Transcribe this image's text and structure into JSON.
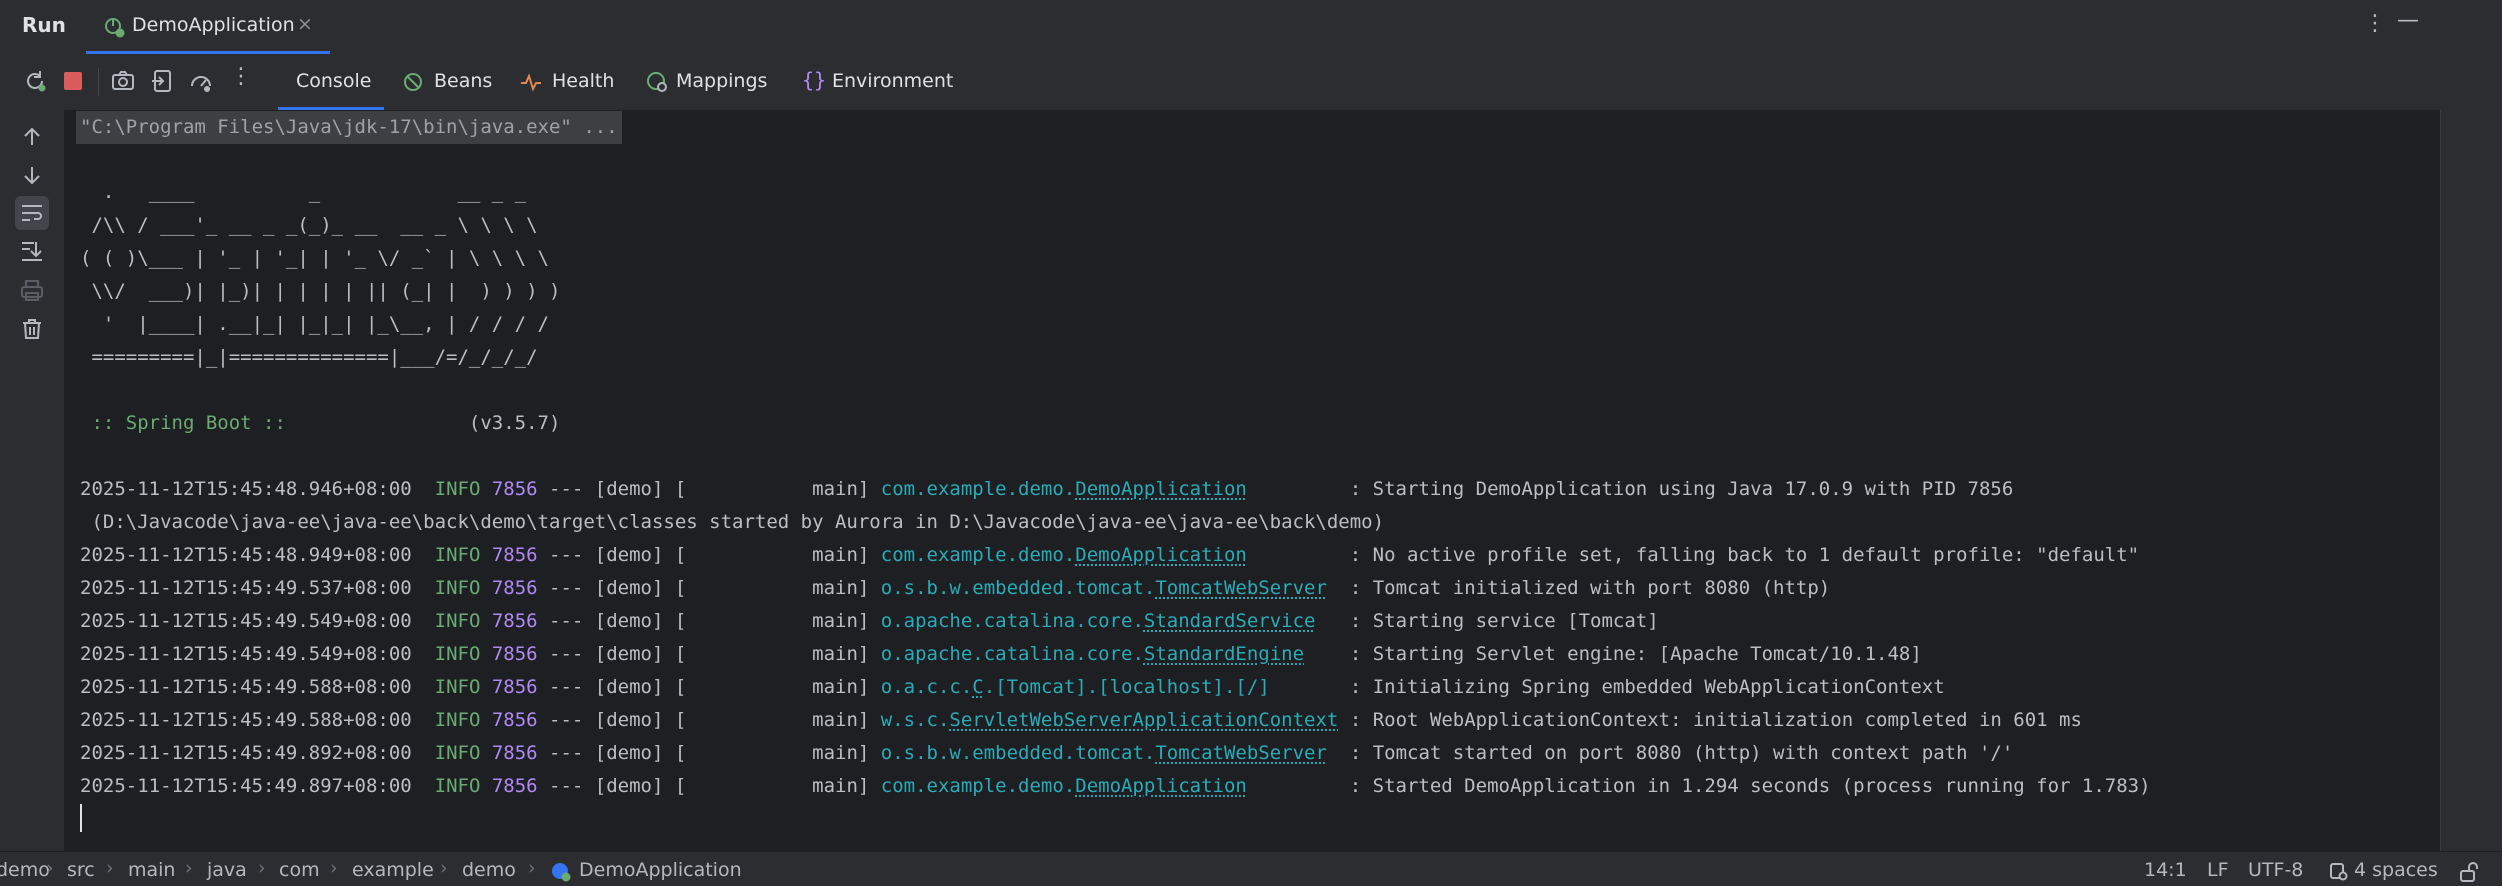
{
  "header": {
    "run_label": "Run",
    "tab_label": "DemoApplication",
    "tab_close": "×",
    "more_glyph": "⋮",
    "minimize_glyph": "—"
  },
  "toolbar": {
    "tabs": [
      {
        "label": "Console",
        "icon": "console",
        "active": true
      },
      {
        "label": "Beans",
        "icon": "beans-icon"
      },
      {
        "label": "Health",
        "icon": "health-icon"
      },
      {
        "label": "Mappings",
        "icon": "mappings-icon"
      },
      {
        "label": "Environment",
        "icon": "environment-icon"
      }
    ],
    "more_glyph": "⋮"
  },
  "console": {
    "command": "\"C:\\Program Files\\Java\\jdk-17\\bin\\java.exe\" ...",
    "banner": [
      "  .   ____          _            __ _ _",
      " /\\\\ / ___'_ __ _ _(_)_ __  __ _ \\ \\ \\ \\",
      "( ( )\\___ | '_ | '_| | '_ \\/ _` | \\ \\ \\ \\",
      " \\\\/  ___)| |_)| | | | | || (_| |  ) ) ) )",
      "  '  |____| .__|_| |_|_| |_\\__, | / / / /",
      " =========|_|==============|___/=/_/_/_/"
    ],
    "spring_boot_label": " :: Spring Boot :: ",
    "spring_boot_version": "               (v3.5.7)",
    "logs": [
      {
        "ts": "2025-11-12T15:45:48.946+08:00",
        "level": "INFO",
        "pid": "7856",
        "mid": " --- [demo] [           main] ",
        "logger_prefix": "com.example.demo.",
        "logger_class": "DemoApplication",
        "pad": "         ",
        "message": ": Starting DemoApplication using Java 17.0.9 with PID 7856"
      },
      {
        "ts": "2025-11-12T15:45:48.949+08:00",
        "level": "INFO",
        "pid": "7856",
        "mid": " --- [demo] [           main] ",
        "logger_prefix": "com.example.demo.",
        "logger_class": "DemoApplication",
        "pad": "         ",
        "message": ": No active profile set, falling back to 1 default profile: \"default\""
      },
      {
        "ts": "2025-11-12T15:45:49.537+08:00",
        "level": "INFO",
        "pid": "7856",
        "mid": " --- [demo] [           main] ",
        "logger_prefix": "o.s.b.w.embedded.tomcat.",
        "logger_class": "TomcatWebServer",
        "pad": "  ",
        "message": ": Tomcat initialized with port 8080 (http)"
      },
      {
        "ts": "2025-11-12T15:45:49.549+08:00",
        "level": "INFO",
        "pid": "7856",
        "mid": " --- [demo] [           main] ",
        "logger_prefix": "o.apache.catalina.core.",
        "logger_class": "StandardService",
        "pad": "   ",
        "message": ": Starting service [Tomcat]"
      },
      {
        "ts": "2025-11-12T15:45:49.549+08:00",
        "level": "INFO",
        "pid": "7856",
        "mid": " --- [demo] [           main] ",
        "logger_prefix": "o.apache.catalina.core.",
        "logger_class": "StandardEngine",
        "pad": "    ",
        "message": ": Starting Servlet engine: [Apache Tomcat/10.1.48]"
      },
      {
        "ts": "2025-11-12T15:45:49.588+08:00",
        "level": "INFO",
        "pid": "7856",
        "mid": " --- [demo] [           main] ",
        "logger_prefix": "o.a.c.c.",
        "logger_class": "C",
        "logger_suffix": ".[Tomcat].[localhost].[/]",
        "pad": "       ",
        "message": ": Initializing Spring embedded WebApplicationContext"
      },
      {
        "ts": "2025-11-12T15:45:49.588+08:00",
        "level": "INFO",
        "pid": "7856",
        "mid": " --- [demo] [           main] ",
        "logger_prefix": "w.s.c.",
        "logger_class": "ServletWebServerApplicationContext",
        "pad": " ",
        "message": ": Root WebApplicationContext: initialization completed in 601 ms"
      },
      {
        "ts": "2025-11-12T15:45:49.892+08:00",
        "level": "INFO",
        "pid": "7856",
        "mid": " --- [demo] [           main] ",
        "logger_prefix": "o.s.b.w.embedded.tomcat.",
        "logger_class": "TomcatWebServer",
        "pad": "  ",
        "message": ": Tomcat started on port 8080 (http) with context path '/'"
      },
      {
        "ts": "2025-11-12T15:45:49.897+08:00",
        "level": "INFO",
        "pid": "7856",
        "mid": " --- [demo] [           main] ",
        "logger_prefix": "com.example.demo.",
        "logger_class": "DemoApplication",
        "pad": "         ",
        "message": ": Started DemoApplication in 1.294 seconds (process running for 1.783)"
      }
    ],
    "continuation": " (D:\\Javacode\\java-ee\\java-ee\\back\\demo\\target\\classes started by Aurora in D:\\Javacode\\java-ee\\java-ee\\back\\demo)"
  },
  "statusbar": {
    "breadcrumbs": [
      "demo",
      "src",
      "main",
      "java",
      "com",
      "example",
      "demo",
      "DemoApplication"
    ],
    "separator": "›",
    "position": "14:1",
    "line_ending": "LF",
    "encoding": "UTF-8",
    "indent": "4 spaces"
  },
  "colors": {
    "accent": "#3574f0",
    "background": "#1e1f22",
    "panel": "#2b2d30",
    "info": "#6aab73",
    "pid": "#b189f5",
    "logger": "#2aacb8"
  }
}
